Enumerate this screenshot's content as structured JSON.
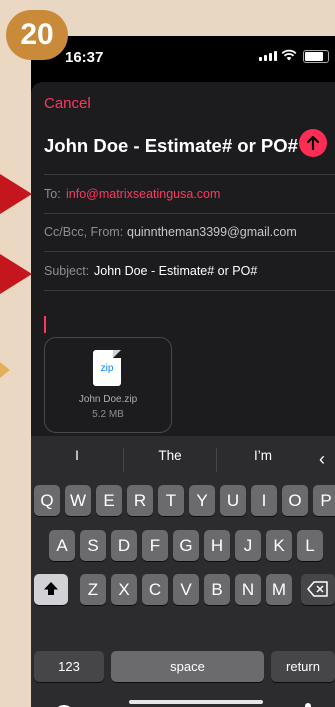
{
  "step_number": "20",
  "status": {
    "time": "16:37"
  },
  "mail": {
    "cancel": "Cancel",
    "title": "John Doe - Estimate# or PO#",
    "to_label": "To:",
    "to_value": "info@matrixseatingusa.com",
    "cc_label": "Cc/Bcc, From:",
    "cc_value": "quinntheman3399@gmail.com",
    "subject_label": "Subject:",
    "subject_value": "John Doe - Estimate# or PO#"
  },
  "attachment": {
    "icon_text": "zip",
    "name": "John Doe.zip",
    "size": "5.2 MB"
  },
  "keyboard": {
    "suggestions": [
      "I",
      "The",
      "I’m"
    ],
    "row1": [
      "Q",
      "W",
      "E",
      "R",
      "T",
      "Y",
      "U",
      "I",
      "O",
      "P"
    ],
    "row2": [
      "A",
      "S",
      "D",
      "F",
      "G",
      "H",
      "J",
      "K",
      "L"
    ],
    "row3": [
      "Z",
      "X",
      "C",
      "V",
      "B",
      "N",
      "M"
    ],
    "numbers": "123",
    "space": "space",
    "return": "return"
  },
  "colors": {
    "accent": "#ff375f",
    "send": "#ff2d55",
    "arrow": "#c4161c",
    "badge": "#c98a3a"
  }
}
